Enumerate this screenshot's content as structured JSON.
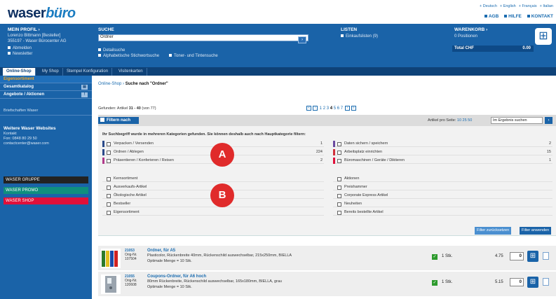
{
  "header": {
    "logo_a": "waser",
    "logo_b": "büro",
    "languages": [
      "+ Deutsch",
      "+ English",
      "+ Français",
      "+ Italian"
    ],
    "service": [
      "AGB",
      "HILFE",
      "KONTAKT"
    ]
  },
  "profile": {
    "title": "MEIN PROFIL ›",
    "user": "Lorenzo Bittmann [Besteller]",
    "company": "355197 - Waser Bürocenter AG",
    "logout": "Abmelden",
    "newsletter": "Newsletter"
  },
  "search": {
    "title": "SUCHE",
    "value": "Ordner",
    "go": "›",
    "detail": "Detailsuche",
    "alpha": "Alphabetische Stichwortsuche",
    "toner": "Toner- und Tintensuche"
  },
  "lists": {
    "title": "LISTEN",
    "item": "Einkaufslisten (9)"
  },
  "cart": {
    "title": "WARENKORB ›",
    "positions": "0 Positionen",
    "total_label": "Total CHF",
    "total_value": "0.00"
  },
  "tabs": [
    "Online-Shop",
    "My Shop",
    "Stempel Konfiguration",
    "Visitenkarten"
  ],
  "sidebar": {
    "items": [
      "Eigensortiment",
      "Gesamtkatalog",
      "Angebote / Aktionen"
    ],
    "tag1": "▤",
    "tag2": "!",
    "brief": "Briefschaften Waser",
    "ww_title": "Weitere Waser Websites",
    "ww_lines": [
      "Kontakt",
      "Fon: 0848 80 29 50",
      "contactcenter@waser.com"
    ],
    "groups": [
      "WASER GRUPPE",
      "WASER PROMO",
      "WASER SHOP"
    ]
  },
  "colors": {
    "gruppe": "#222222",
    "promo": "#0f8f7d",
    "shop": "#e0103a"
  },
  "breadcrumb": {
    "home": "Online-Shop",
    "sep": "›",
    "current": "Suche nach \"Ordner\""
  },
  "results": {
    "found_prefix": "Gefunden: Artikel ",
    "range": "31 - 40",
    "found_suffix": " (von 77)",
    "pages": [
      "1",
      "2",
      "3",
      "4",
      "5",
      "6",
      "7"
    ],
    "current_page": "4"
  },
  "filter": {
    "button": "Filtern nach",
    "per_page_label": "Artikel pro Seite: ",
    "per_page": "10 25 50",
    "result_search": "Im Ergebnis suchen",
    "go": "›",
    "info": "Ihr Suchbegriff wurde in mehreren Kategorien gefunden. Sie können deshalb auch nach Hauptkategorie filtern:"
  },
  "categories_left": [
    {
      "label": "Verpacken / Versenden",
      "count": "1",
      "color": "#2a4a8a"
    },
    {
      "label": "Ordnen / Ablegen",
      "count": "224",
      "color": "#2a4a8a"
    },
    {
      "label": "Präsentieren / Konferieren / Reisen",
      "count": "2",
      "color": "#b03a8a"
    }
  ],
  "categories_right": [
    {
      "label": "Daten sichern / speichern",
      "count": "2",
      "color": "#6a4aa0"
    },
    {
      "label": "Arbeitsplatz einrichten",
      "count": "15",
      "color": "#d0303a"
    },
    {
      "label": "Büromaschinen / Geräte / Diktieren",
      "count": "1",
      "color": "#e0103a"
    }
  ],
  "options_left": [
    "Kernsortiment",
    "Ausverkaufs-Artikel",
    "Ökologische Artikel",
    "Bestseller",
    "Eigensortiment"
  ],
  "options_right": [
    "Aktionen",
    "Preishammer",
    "Corporate Express Artikel",
    "Neuheiten",
    "Bereits bestellte Artikel"
  ],
  "markers": [
    "A",
    "B"
  ],
  "actions": {
    "reset": "Filter zurücksetzen",
    "apply": "Filter anwenden"
  },
  "products": [
    {
      "num": "21053",
      "orig_label": "Orig-Nr.",
      "orig": "107504",
      "title": "Ordner, für A5",
      "desc": "Plasticolor, Rückenbreite 40mm, Rückenschild auswechselbar, 215x250mm, BIELLA",
      "opt": "Optimale Menge = 10 Stk.",
      "stock": "1 Stk.",
      "price": "4.75",
      "qty": "0"
    },
    {
      "num": "21055",
      "orig_label": "Orig-Nr.",
      "orig": "120608",
      "title": "Coupons-Ordner, für A6 hoch",
      "desc": "80mm Rückenbreite, Rückenschild auswechselbar, 165x180mm, BIELLA, grau",
      "opt": "Optimale Menge = 10 Stk.",
      "stock": "1 Stk.",
      "price": "5.15",
      "qty": "0"
    }
  ]
}
